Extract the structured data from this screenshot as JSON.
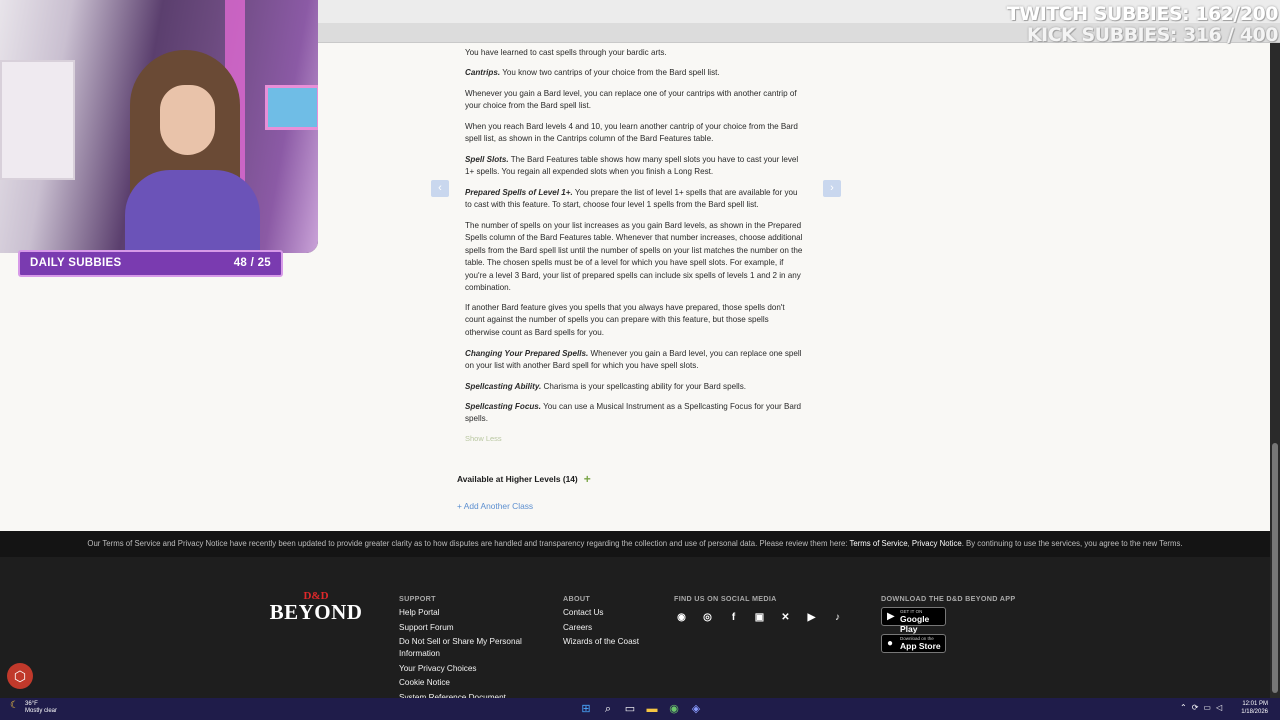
{
  "content": {
    "paragraphs": [
      {
        "lead": "",
        "text": "You have learned to cast spells through your bardic arts."
      },
      {
        "lead": "Cantrips.",
        "text": " You know two cantrips of your choice from the Bard spell list."
      },
      {
        "lead": "",
        "text": "Whenever you gain a Bard level, you can replace one of your cantrips with another cantrip of your choice from the Bard spell list."
      },
      {
        "lead": "",
        "text": "When you reach Bard levels 4 and 10, you learn another cantrip of your choice from the Bard spell list, as shown in the Cantrips column of the Bard Features table."
      },
      {
        "lead": "Spell Slots.",
        "text": " The Bard Features table shows how many spell slots you have to cast your level 1+ spells. You regain all expended slots when you finish a Long Rest."
      },
      {
        "lead": "Prepared Spells of Level 1+.",
        "text": " You prepare the list of level 1+ spells that are available for you to cast with this feature. To start, choose four level 1 spells from the Bard spell list."
      },
      {
        "lead": "",
        "text": "The number of spells on your list increases as you gain Bard levels, as shown in the Prepared Spells column of the Bard Features table. Whenever that number increases, choose additional spells from the Bard spell list until the number of spells on your list matches the number on the table. The chosen spells must be of a level for which you have spell slots. For example, if you're a level 3 Bard, your list of prepared spells can include six spells of levels 1 and 2 in any combination."
      },
      {
        "lead": "",
        "text": "If another Bard feature gives you spells that you always have prepared, those spells don't count against the number of spells you can prepare with this feature, but those spells otherwise count as Bard spells for you."
      },
      {
        "lead": "Changing Your Prepared Spells.",
        "text": " Whenever you gain a Bard level, you can replace one spell on your list with another Bard spell for which you have spell slots."
      },
      {
        "lead": "Spellcasting Ability.",
        "text": " Charisma is your spellcasting ability for your Bard spells."
      },
      {
        "lead": "Spellcasting Focus.",
        "text": " You can use a Musical Instrument as a Spellcasting Focus for your Bard spells."
      }
    ],
    "show_less": "Show Less",
    "higher_levels": "Available at Higher Levels (14)",
    "higher_levels_plus": "+",
    "add_class": "+ Add Another Class",
    "prev_arrow": "‹",
    "next_arrow": "›"
  },
  "terms": {
    "text": "Our Terms of Service and Privacy Notice have recently been updated to provide greater clarity as to how disputes are handled and transparency regarding the collection and use of personal data. Please review them here: ",
    "tos": "Terms of Service",
    "sep": ", ",
    "privacy": "Privacy Notice",
    "tail": ". By continuing to use the services, you agree to the new Terms."
  },
  "footer": {
    "logo_top": "D&D",
    "logo_main": "BEYOND",
    "support": {
      "heading": "SUPPORT",
      "links": [
        "Help Portal",
        "Support Forum",
        "Do Not Sell or Share My Personal Information",
        "Your Privacy Choices",
        "Cookie Notice",
        "System Reference Document"
      ]
    },
    "about": {
      "heading": "ABOUT",
      "links": [
        "Contact Us",
        "Careers",
        "Wizards of the Coast"
      ]
    },
    "social": {
      "heading": "FIND US ON SOCIAL MEDIA",
      "icons": [
        "discord-icon",
        "instagram-icon",
        "facebook-icon",
        "twitch-icon",
        "x-icon",
        "youtube-icon",
        "tiktok-icon"
      ]
    },
    "app": {
      "heading": "DOWNLOAD THE D&D BEYOND APP",
      "google_small": "GET IT ON",
      "google": "Google Play",
      "apple_small": "Download on the",
      "apple": "App Store"
    }
  },
  "overlay": {
    "daily_label": "DAILY SUBBIES",
    "daily_count": "48 / 25",
    "twitch_subbies": "TWITCH SUBBIES: 162/200",
    "kick_subbies": "KICK SUBBIES: 316 / 400"
  },
  "taskbar": {
    "temp": "36°F",
    "weather": "Mostly clear",
    "time": "12:01 PM",
    "date": "1/18/2026"
  },
  "colors": {
    "accent_green": "#7aa547",
    "link_blue": "#5c8fd0",
    "overlay_purple": "#7a3bb0",
    "dndbeyond_red": "#e0282a"
  }
}
